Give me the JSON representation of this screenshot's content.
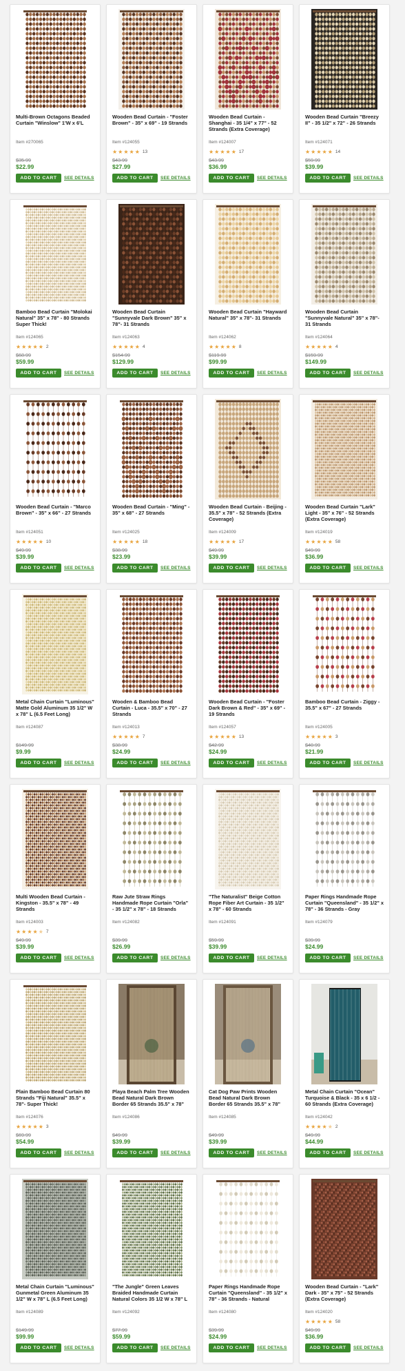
{
  "theme": {
    "accent": "#3b8b2c",
    "star": "#e8a33c",
    "strike": "#888888"
  },
  "labels": {
    "add_to_cart": "ADD TO CART",
    "see_details": "SEE DETAILS"
  },
  "products": [
    {
      "title": "Multi-Brown Octagons Beaded Curtain \"Winslow\" 1'W x 6'L",
      "item": "Item #270065",
      "rating": 0,
      "reviews": "",
      "old": "$35.99",
      "price": "$22.99",
      "bg": "#ffffff",
      "colors": [
        "#8a5a3a",
        "#5c3520",
        "#a06c46"
      ],
      "style": "beads"
    },
    {
      "title": "Wooden Bead Curtain - \"Foster Brown\" - 35\" x 69\" - 19 Strands",
      "item": "Item #124055",
      "rating": 5,
      "reviews": "13",
      "old": "$43.99",
      "price": "$27.99",
      "bg": "#f4f0ea",
      "colors": [
        "#8b5a3c",
        "#5a3622",
        "#b07a50"
      ],
      "style": "beads"
    },
    {
      "title": "Wooden Bead Curtain - Shanghai - 35 1/4\" x 77\" - 52 Strands (Extra Coverage)",
      "item": "Item #124007",
      "rating": 5,
      "reviews": "17",
      "old": "$43.99",
      "price": "$36.99",
      "bg": "#f0e6da",
      "colors": [
        "#7b4a30",
        "#a0323a",
        "#c08a5e"
      ],
      "style": "zigzag"
    },
    {
      "title": "Wooden Bead Curtain \"Breezy II\" - 35 1/2\" x 72\" - 26 Strands",
      "item": "Item #124071",
      "rating": 5,
      "reviews": "14",
      "old": "$59.99",
      "price": "$39.99",
      "bg": "#2a2622",
      "colors": [
        "#d8c7a3",
        "#e6d8b8",
        "#bba67e"
      ],
      "style": "shells"
    },
    {
      "title": "Bamboo Bead Curtain \"Molokai Natural\" 35\" x 78\" - 80 Strands Super Thick!",
      "item": "Item #124065",
      "rating": 5,
      "reviews": "2",
      "old": "$68.99",
      "price": "$59.99",
      "bg": "#ffffff",
      "colors": [
        "#d9c6a0",
        "#c8b48c",
        "#e6d6b4"
      ],
      "style": "dense"
    },
    {
      "title": "Wooden Bead Curtain \"Sunnyvale Dark Brown\" 35\" x 78\"- 31 Strands",
      "item": "Item #124063",
      "rating": 5,
      "reviews": "4",
      "old": "$154.99",
      "price": "$129.99",
      "bg": "#3a2418",
      "colors": [
        "#6b3e28",
        "#8a5236",
        "#4a2a1a"
      ],
      "style": "beads"
    },
    {
      "title": "Wooden Bead Curtain \"Hayward Natural\" 35\" x 78\"- 31 Strands",
      "item": "Item #124062",
      "rating": 5,
      "reviews": "8",
      "old": "$119.99",
      "price": "$99.99",
      "bg": "#f6efe2",
      "colors": [
        "#e3c48e",
        "#d4ad72",
        "#ecd4a4"
      ],
      "style": "beads"
    },
    {
      "title": "Wooden Bead Curtain \"Sunnyvale Natural\" 35\" x 78\"- 31 Strands",
      "item": "Item #124064",
      "rating": 5,
      "reviews": "4",
      "old": "$159.99",
      "price": "$149.99",
      "bg": "#f3eee6",
      "colors": [
        "#b8a88e",
        "#9c8a70",
        "#cdbfa6"
      ],
      "style": "beads"
    },
    {
      "title": "Wooden Bead Curtain - \"Marco Brown\" - 35\" x 66\" - 27 Strands",
      "item": "Item #124051",
      "rating": 5,
      "reviews": "10",
      "old": "$49.99",
      "price": "$39.99",
      "bg": "#ffffff",
      "colors": [
        "#6a3c26",
        "#8c5638",
        "#4a2818"
      ],
      "style": "sparse"
    },
    {
      "title": "Wooden Bead Curtain - \"Ming\" - 35\" x 68\" - 27 Strands",
      "item": "Item #124025",
      "rating": 5,
      "reviews": "18",
      "old": "$38.99",
      "price": "$23.99",
      "bg": "#ffffff",
      "colors": [
        "#7a4a30",
        "#9a6040",
        "#5c3420"
      ],
      "style": "zigzag"
    },
    {
      "title": "Wooden Bead Curtain - Beijing - 35.5\" x 78\" - 52 Strands (Extra Coverage)",
      "item": "Item #124009",
      "rating": 5,
      "reviews": "17",
      "old": "$49.99",
      "price": "$39.99",
      "bg": "#f2e8d8",
      "colors": [
        "#7a5034",
        "#c7a57a",
        "#a07650"
      ],
      "style": "diamond"
    },
    {
      "title": "Wooden Bead Curtain \"Lark\" Light - 35\" x 76\" - 52 Strands (Extra Coverage)",
      "item": "Item #124019",
      "rating": 5,
      "reviews": "58",
      "old": "$49.99",
      "price": "$36.99",
      "bg": "#f4ede2",
      "colors": [
        "#c9a880",
        "#b8926a",
        "#dcc09c"
      ],
      "style": "dense"
    },
    {
      "title": "Metal Chain Curtain \"Luminous\" Matte Gold Aluminum 35 1/2\" W x 78\" L (6.5 Feet Long)",
      "item": "Item #124087",
      "rating": 0,
      "reviews": "",
      "old": "$149.99",
      "price": "$9.99",
      "bg": "#f7f3e6",
      "colors": [
        "#d8c58a",
        "#c9b473",
        "#e6d8a8"
      ],
      "style": "dense"
    },
    {
      "title": "Wooden & Bamboo Bead Curtain - Luca - 35.5\" x 70\" - 27 Strands",
      "item": "Item #124013",
      "rating": 5,
      "reviews": "7",
      "old": "$38.99",
      "price": "$24.99",
      "bg": "#ffffff",
      "colors": [
        "#6c3a26",
        "#8e5436",
        "#a8704c"
      ],
      "style": "beads"
    },
    {
      "title": "Wooden Bead Curtain - \"Foster Dark Brown & Red\" - 35\" x 69\" - 19 Strands",
      "item": "Item #124057",
      "rating": 5,
      "reviews": "13",
      "old": "$42.99",
      "price": "$24.99",
      "bg": "#ffffff",
      "colors": [
        "#4a2a1c",
        "#a8323a",
        "#6a3a26"
      ],
      "style": "beads"
    },
    {
      "title": "Bamboo Bead Curtain - Ziggy - 35.5\" x 67\" - 27 Strands",
      "item": "Item #124005",
      "rating": 5,
      "reviews": "3",
      "old": "$40.99",
      "price": "$21.99",
      "bg": "#ffffff",
      "colors": [
        "#7a4630",
        "#b8404c",
        "#c99a6a"
      ],
      "style": "sparse"
    },
    {
      "title": "Multi Wooden Bead Curtain - Kingston - 35.5\" x 78\" - 49 Strands",
      "item": "Item #124003",
      "rating": 4.5,
      "reviews": "7",
      "old": "$49.99",
      "price": "$39.99",
      "bg": "#f6f0e6",
      "colors": [
        "#5c3422",
        "#8a5838",
        "#c49a6c"
      ],
      "style": "dense"
    },
    {
      "title": "Raw Jute Straw Rings Handmade Rope Curtain \"Orla\" - 35 1/2\" x 78\" - 18 Strands",
      "item": "Item #124082",
      "rating": 0,
      "reviews": "",
      "old": "$39.99",
      "price": "$26.99",
      "bg": "#ffffff",
      "colors": [
        "#a8a080",
        "#8e8668",
        "#c0b898"
      ],
      "style": "sparse"
    },
    {
      "title": "\"The Naturalist\" Beige Cotton Rope Fiber Art Curtain - 35 1/2\" x 78\" - 60 Strands",
      "item": "Item #124091",
      "rating": 0,
      "reviews": "",
      "old": "$59.99",
      "price": "$39.99",
      "bg": "#f7f4ee",
      "colors": [
        "#e2d8c4",
        "#d4c8b0",
        "#ece4d4"
      ],
      "style": "dense"
    },
    {
      "title": "Paper Rings Handmade Rope Curtain \"Queensland\" - 35 1/2\" x 78\" - 36 Strands - Gray",
      "item": "Item #124079",
      "rating": 0,
      "reviews": "",
      "old": "$39.99",
      "price": "$24.99",
      "bg": "#ffffff",
      "colors": [
        "#b0aca4",
        "#9a968e",
        "#c8c4bc"
      ],
      "style": "sparse"
    },
    {
      "title": "Plain Bamboo Bead Curtain 80 Strands \"Fiji Natural\" 35.5\" x 78\"- Super Thick!",
      "item": "Item #124076",
      "rating": 5,
      "reviews": "3",
      "old": "$69.99",
      "price": "$54.99",
      "bg": "#ffffff",
      "colors": [
        "#c9b482",
        "#b8a270",
        "#dac89a"
      ],
      "style": "dense"
    },
    {
      "title": "Playa Beach Palm Tree Wooden Bead Natural Dark Brown Border 65 Strands 35.5\" x 78\"",
      "item": "Item #124086",
      "rating": 0,
      "reviews": "",
      "old": "$49.99",
      "price": "$39.99",
      "bg": "#8a7a66",
      "colors": [
        "#5a4632",
        "#c8b48c",
        "#3c5a3a"
      ],
      "style": "room"
    },
    {
      "title": "Cat Dog Paw Prints Wooden Bead Natural Dark Brown Border 65 Strands 35.5\" x 78\"",
      "item": "Item #124085",
      "rating": 0,
      "reviews": "",
      "old": "$49.99",
      "price": "$39.99",
      "bg": "#9a8c7a",
      "colors": [
        "#6a5640",
        "#d8c8a8",
        "#4a6a86"
      ],
      "style": "room"
    },
    {
      "title": "Metal Chain Curtain \"Ocean\" Turquoise & Black - 35 x 6 1/2 - 60 Strands (Extra Coverage)",
      "item": "Item #124042",
      "rating": 4.5,
      "reviews": "2",
      "old": "$49.99",
      "price": "$44.99",
      "bg": "#e6e6e2",
      "colors": [
        "#1a1a1a",
        "#2aa0b8",
        "#5ac4d6"
      ],
      "style": "door"
    },
    {
      "title": "Metal Chain Curtain \"Luminous\" Gunmetal Green Aluminum 35 1/2\" W x 78\" L (6.5 Feet Long)",
      "item": "Item #124089",
      "rating": 0,
      "reviews": "",
      "old": "$149.99",
      "price": "$99.99",
      "bg": "#c8ccc4",
      "colors": [
        "#6a7064",
        "#8a9084",
        "#565c52"
      ],
      "style": "dense"
    },
    {
      "title": "\"The Jungle\" Green Leaves Braided Handmade Curtain Natural Colors 35 1/2 W x 78\" L",
      "item": "Item #124092",
      "rating": 0,
      "reviews": "",
      "old": "$77.99",
      "price": "$59.99",
      "bg": "#ffffff",
      "colors": [
        "#7a8a60",
        "#5a6a44",
        "#a8b088"
      ],
      "style": "dense"
    },
    {
      "title": "Paper Rings Handmade Rope Curtain \"Queensland\" - 35 1/2\" x 78\" - 36 Strands - Natural",
      "item": "Item #124080",
      "rating": 0,
      "reviews": "",
      "old": "$39.99",
      "price": "$24.99",
      "bg": "#ffffff",
      "colors": [
        "#e2dccc",
        "#d2cab6",
        "#eee8dc"
      ],
      "style": "sparse"
    },
    {
      "title": "Wooden Bead Curtain - \"Lark\" Dark - 35\" x 75\" - 52 Strands (Extra Coverage)",
      "item": "Item #124020",
      "rating": 5,
      "reviews": "58",
      "old": "$49.99",
      "price": "$36.99",
      "bg": "#6a3a2a",
      "colors": [
        "#8a4a34",
        "#a8604a",
        "#5a2e20"
      ],
      "style": "dense"
    }
  ]
}
